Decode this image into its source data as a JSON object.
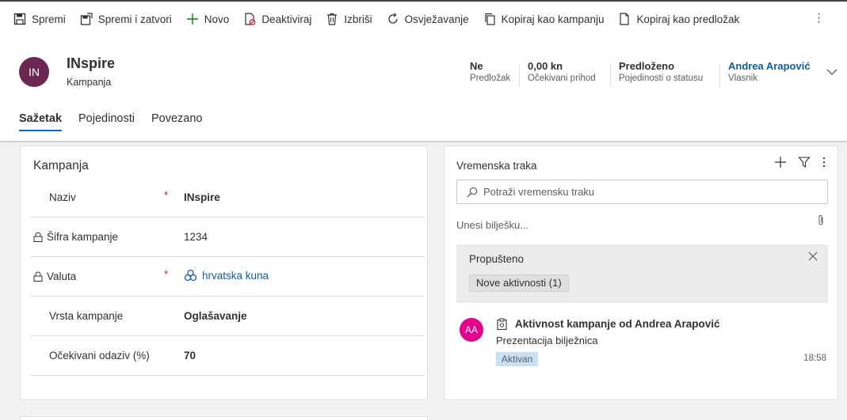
{
  "toolbar": {
    "save": "Spremi",
    "save_close": "Spremi i zatvori",
    "new": "Novo",
    "deactivate": "Deaktiviraj",
    "delete": "Izbriši",
    "refresh": "Osvježavanje",
    "copy_campaign": "Kopiraj kao kampanju",
    "copy_template": "Kopiraj kao predložak",
    "more": "⋮"
  },
  "record": {
    "initials": "IN",
    "title": "INspire",
    "entity": "Kampanja",
    "avatar_color": "#6b2752"
  },
  "header_fields": [
    {
      "value": "Ne",
      "label": "Predložak"
    },
    {
      "value": "0,00 kn",
      "label": "Očekivani prihod"
    },
    {
      "value": "Predloženo",
      "label": "Pojedinosti o statusu"
    },
    {
      "value": "Andrea Arapović",
      "label": "Vlasnik"
    }
  ],
  "tabs": [
    {
      "label": "Sažetak",
      "active": true
    },
    {
      "label": "Pojedinosti",
      "active": false
    },
    {
      "label": "Povezano",
      "active": false
    }
  ],
  "form": {
    "section_title": "Kampanja",
    "fields": [
      {
        "label": "Naziv",
        "required": "*",
        "value": "INspire"
      },
      {
        "label": "Šifra kampanje",
        "value": "1234"
      },
      {
        "label": "Valuta",
        "required": "*",
        "value": "hrvatska kuna"
      },
      {
        "label": "Vrsta kampanje",
        "value": "Oglašavanje"
      },
      {
        "label": "Očekivani odaziv (%)",
        "value": "70"
      }
    ]
  },
  "timeline": {
    "title": "Vremenska traka",
    "search_placeholder": "Potraži vremensku traku",
    "note_placeholder": "Unesi bilješku...",
    "missed_title": "Propušteno",
    "missed_badge": "Nove aktivnosti (1)",
    "activity": {
      "initials": "AA",
      "title": "Aktivnost kampanje od Andrea Arapović",
      "subtitle": "Prezentacija bilježnica",
      "status": "Aktivan",
      "time": "18:58"
    }
  },
  "colors": {
    "accent": "#0f6cbd",
    "link": "#115ea3",
    "required": "#c50f1f",
    "activity_avatar": "#e3008c"
  }
}
